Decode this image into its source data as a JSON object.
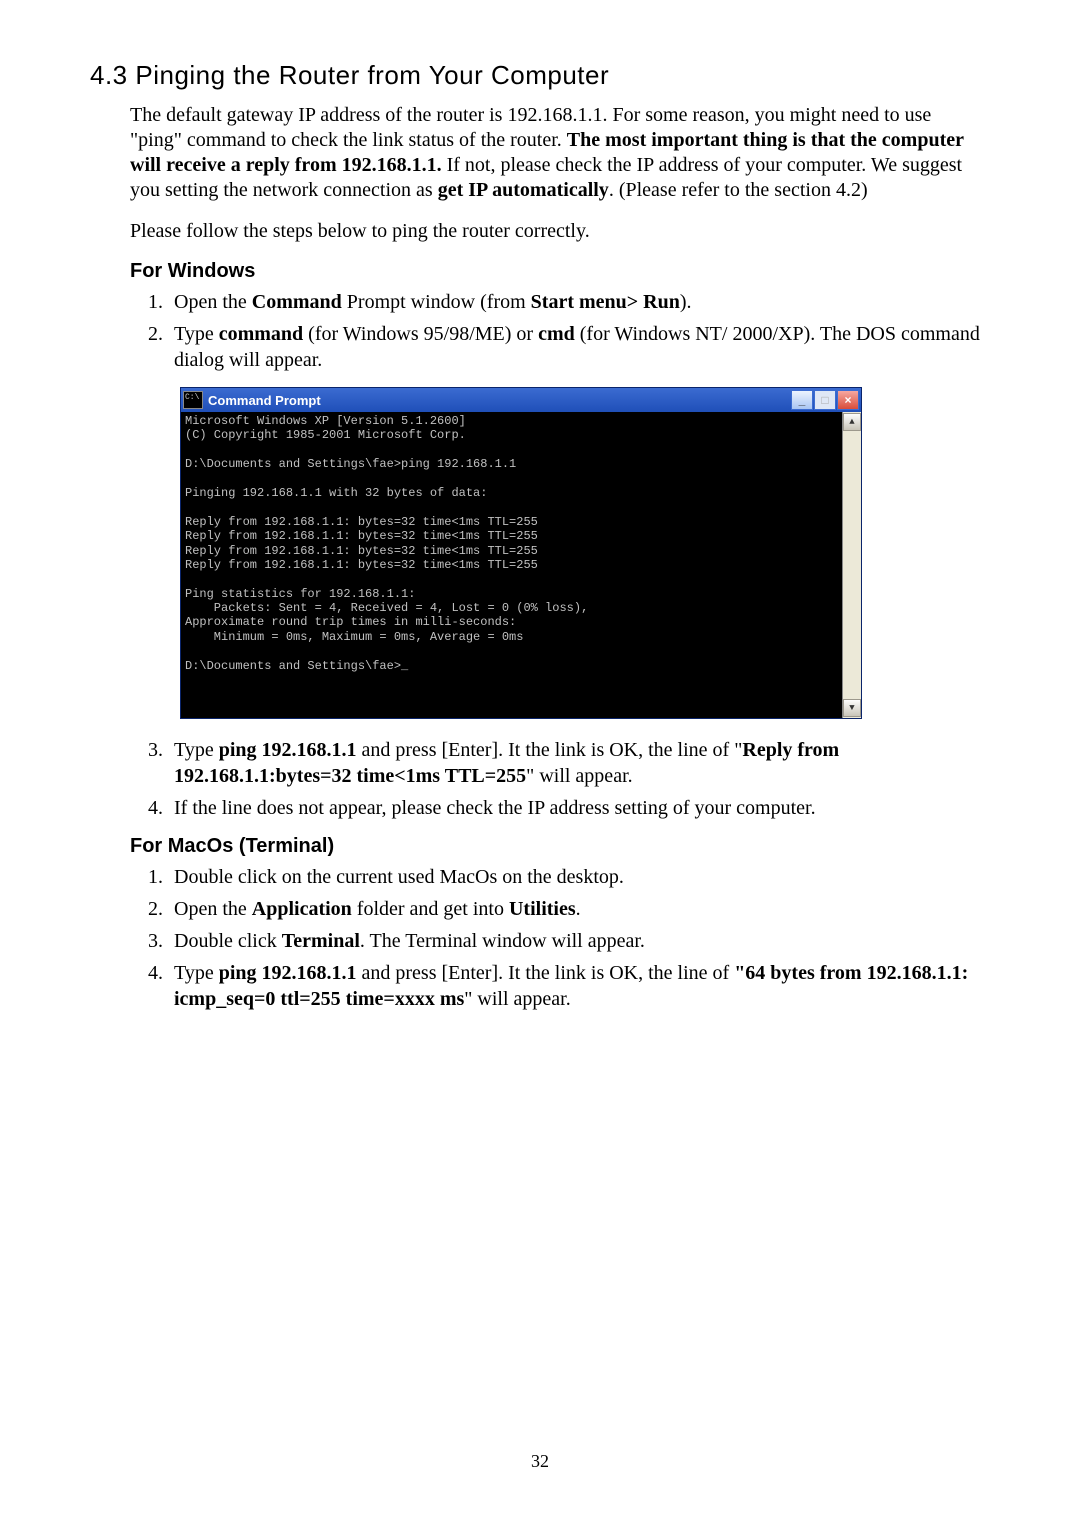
{
  "section_title": "4.3 Pinging the Router from Your Computer",
  "intro_p1_a": "The default gateway IP address of the router is 192.168.1.1. For some reason, you might need to use \"ping\" command to check the link status of the router. ",
  "intro_p1_b": "The most important thing is that the computer will receive a reply from 192.168.1.1.",
  "intro_p1_c": " If not, please check the IP address of your computer. We suggest you setting the network connection as ",
  "intro_p1_d": "get IP automatically",
  "intro_p1_e": ". (Please refer to the section 4.2)",
  "intro_p2": "Please follow the steps below to ping the router correctly.",
  "win_heading": "For Windows",
  "win_steps_1_a": "Open the ",
  "win_steps_1_b": "Command",
  "win_steps_1_c": " Prompt window (from ",
  "win_steps_1_d": "Start menu> Run",
  "win_steps_1_e": ").",
  "win_steps_2_a": "Type ",
  "win_steps_2_b": "command",
  "win_steps_2_c": " (for Windows 95/98/ME) or ",
  "win_steps_2_d": "cmd",
  "win_steps_2_e": " (for Windows NT/ 2000/XP). The DOS command dialog will appear.",
  "cmd_title": "Command Prompt",
  "cmd_content": "Microsoft Windows XP [Version 5.1.2600]\n(C) Copyright 1985-2001 Microsoft Corp.\n\nD:\\Documents and Settings\\fae>ping 192.168.1.1\n\nPinging 192.168.1.1 with 32 bytes of data:\n\nReply from 192.168.1.1: bytes=32 time<1ms TTL=255\nReply from 192.168.1.1: bytes=32 time<1ms TTL=255\nReply from 192.168.1.1: bytes=32 time<1ms TTL=255\nReply from 192.168.1.1: bytes=32 time<1ms TTL=255\n\nPing statistics for 192.168.1.1:\n    Packets: Sent = 4, Received = 4, Lost = 0 (0% loss),\nApproximate round trip times in milli-seconds:\n    Minimum = 0ms, Maximum = 0ms, Average = 0ms\n\nD:\\Documents and Settings\\fae>_\n\n\n\n",
  "win_steps_3_a": "Type ",
  "win_steps_3_b": "ping 192.168.1.1",
  "win_steps_3_c": " and press [Enter]. It the link is OK, the line of \"",
  "win_steps_3_d": "Reply from 192.168.1.1:bytes=32 time<1ms TTL=255",
  "win_steps_3_e": "\" will appear.",
  "win_steps_4": "If the line does not appear, please check the IP address setting of your computer.",
  "mac_heading": "For MacOs (Terminal)",
  "mac_steps_1": "Double click on the current used MacOs on the desktop.",
  "mac_steps_2_a": "Open the ",
  "mac_steps_2_b": "Application",
  "mac_steps_2_c": " folder and get into ",
  "mac_steps_2_d": "Utilities",
  "mac_steps_2_e": ".",
  "mac_steps_3_a": "Double click ",
  "mac_steps_3_b": "Terminal",
  "mac_steps_3_c": ". The Terminal window will appear.",
  "mac_steps_4_a": "Type ",
  "mac_steps_4_b": "ping 192.168.1.1",
  "mac_steps_4_c": " and press [Enter]. It the link is OK, the line of ",
  "mac_steps_4_d": "\"64 bytes from 192.168.1.1: icmp_seq=0 ttl=255 time=xxxx ms",
  "mac_steps_4_e": "\" will appear.",
  "minimize": "_",
  "maximize": "□",
  "close": "×",
  "scroll_up": "▲",
  "scroll_down": "▼",
  "page_number": "32"
}
